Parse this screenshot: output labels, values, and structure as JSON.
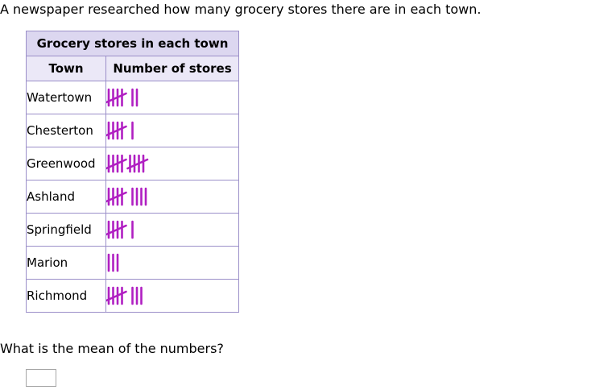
{
  "intro": "A newspaper researched how many grocery stores there are in each town.",
  "table": {
    "title": "Grocery stores in each town",
    "col_town": "Town",
    "col_count": "Number of stores",
    "rows": [
      {
        "town": "Watertown",
        "count": 7
      },
      {
        "town": "Chesterton",
        "count": 6
      },
      {
        "town": "Greenwood",
        "count": 10
      },
      {
        "town": "Ashland",
        "count": 9
      },
      {
        "town": "Springfield",
        "count": 6
      },
      {
        "town": "Marion",
        "count": 3
      },
      {
        "town": "Richmond",
        "count": 8
      }
    ]
  },
  "tally_color": "#b01fc2",
  "question": "What is the mean of the numbers?",
  "answer": {
    "value": "",
    "placeholder": ""
  }
}
